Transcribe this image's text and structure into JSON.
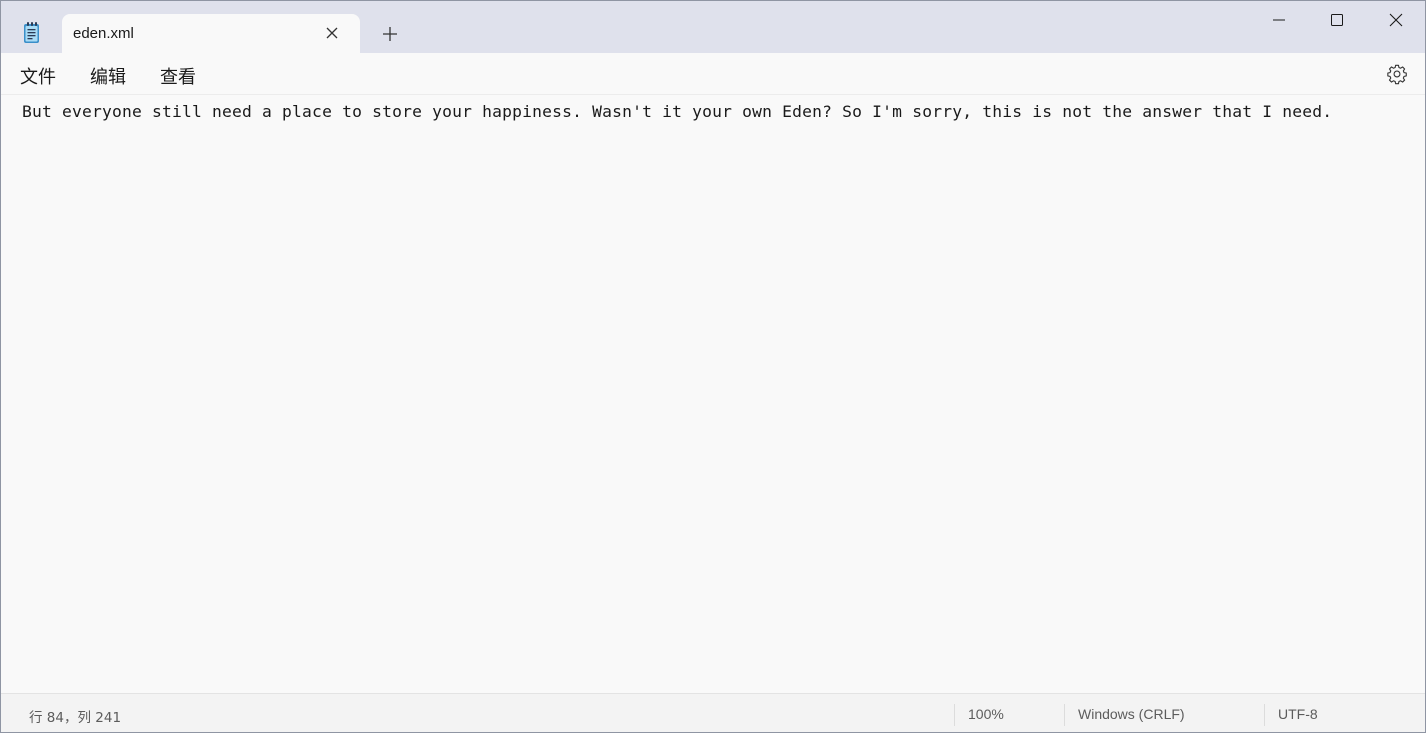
{
  "window": {
    "app_icon": "notepad-icon"
  },
  "tab": {
    "title": "eden.xml",
    "close_icon": "close-icon",
    "new_tab_icon": "plus-icon"
  },
  "window_controls": {
    "minimize_icon": "minimize-icon",
    "maximize_icon": "maximize-icon",
    "close_icon": "close-icon"
  },
  "menu": {
    "file": "文件",
    "edit": "编辑",
    "view": "查看",
    "settings_icon": "gear-icon"
  },
  "editor": {
    "content": "But everyone still need a place to store your happiness. Wasn't it your own Eden? So I'm sorry, this is not the answer that I need."
  },
  "status": {
    "position": "行 84，列 241",
    "zoom": "100%",
    "line_ending": "Windows (CRLF)",
    "encoding": "UTF-8"
  },
  "colors": {
    "titlebar": "#dfe1ec",
    "editor_bg": "#f9f9f9",
    "statusbar": "#f3f3f3",
    "icon_accent": "#3a8fc9"
  }
}
